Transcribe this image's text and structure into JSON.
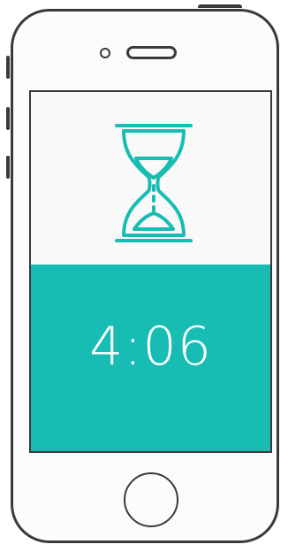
{
  "timer": {
    "display": "4:06"
  },
  "icons": {
    "hourglass": "hourglass-icon",
    "camera": "front-camera-icon",
    "speaker": "earpiece-speaker-icon",
    "home": "home-button"
  },
  "colors": {
    "accent": "#17bdb3",
    "outline": "#3a3a3a",
    "screen_background": "#f9f9f9",
    "timer_text": "#ffffff"
  }
}
